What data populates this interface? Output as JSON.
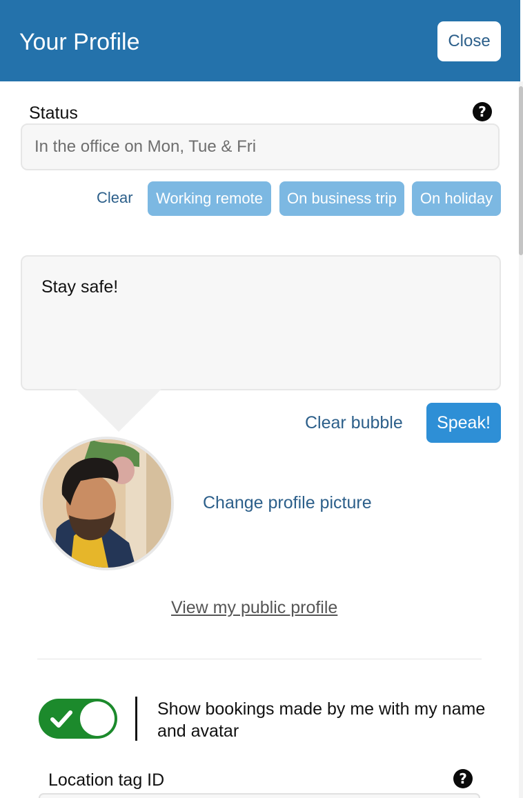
{
  "header": {
    "title": "Your Profile",
    "close_label": "Close",
    "color": "#2472ab"
  },
  "status": {
    "label": "Status",
    "help_icon": "question-circle-icon",
    "placeholder": "In the office on Mon, Tue & Fri",
    "value": "",
    "clear_label": "Clear",
    "presets": [
      "Working remote",
      "On business trip",
      "On holiday"
    ]
  },
  "bubble": {
    "text": "Stay safe!",
    "clear_label": "Clear bubble",
    "speak_label": "Speak!"
  },
  "profile": {
    "change_picture_label": "Change profile picture",
    "public_profile_link": "View my public profile"
  },
  "bookings_toggle": {
    "checked": true,
    "label": "Show bookings made by me with my name and avatar",
    "color": "#1c8a2c"
  },
  "location_tag": {
    "label": "Location tag ID",
    "help_icon": "question-circle-icon"
  }
}
